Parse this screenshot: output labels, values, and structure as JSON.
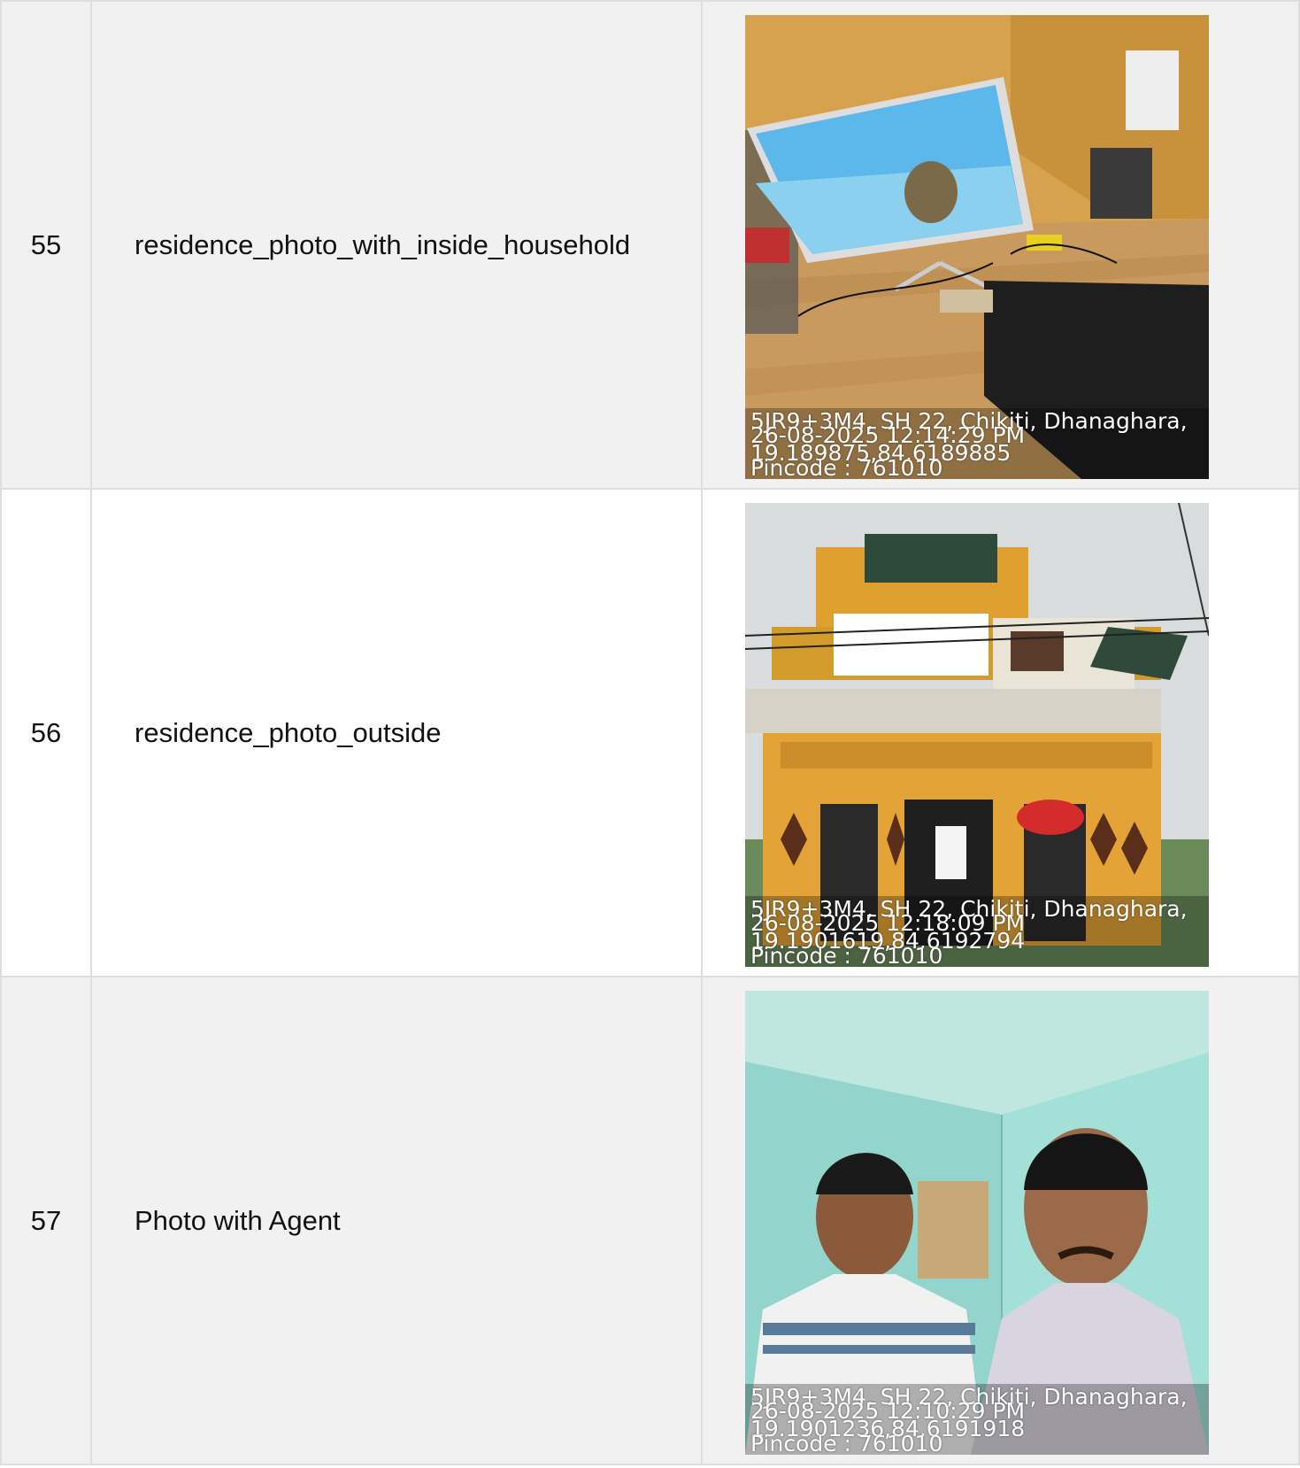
{
  "rows": [
    {
      "number": "55",
      "field": "residence_photo_with_inside_household",
      "photo_stamp": {
        "address": "5JR9+3M4, SH 22, Chikiti, Dhanaghara,",
        "datetime": "26-08-2025 12:14:29 PM",
        "coordinates": "19.189875,84.6189885",
        "pincode": "Pincode : 761010"
      }
    },
    {
      "number": "56",
      "field": "residence_photo_outside",
      "photo_stamp": {
        "address": "5JR9+3M4, SH 22, Chikiti, Dhanaghara,",
        "datetime": "26-08-2025 12:18:09 PM",
        "coordinates": "19.1901619,84.6192794",
        "pincode": "Pincode : 761010"
      }
    },
    {
      "number": "57",
      "field": "Photo with Agent",
      "photo_stamp": {
        "address": "5JR9+3M4, SH 22, Chikiti, Dhanaghara,",
        "datetime": "26-08-2025 12:10:29 PM",
        "coordinates": "19.1901236,84.6191918",
        "pincode": "Pincode : 761010"
      }
    }
  ],
  "colors": {
    "row_shade": "#f1f1f1",
    "border": "#dedede"
  }
}
